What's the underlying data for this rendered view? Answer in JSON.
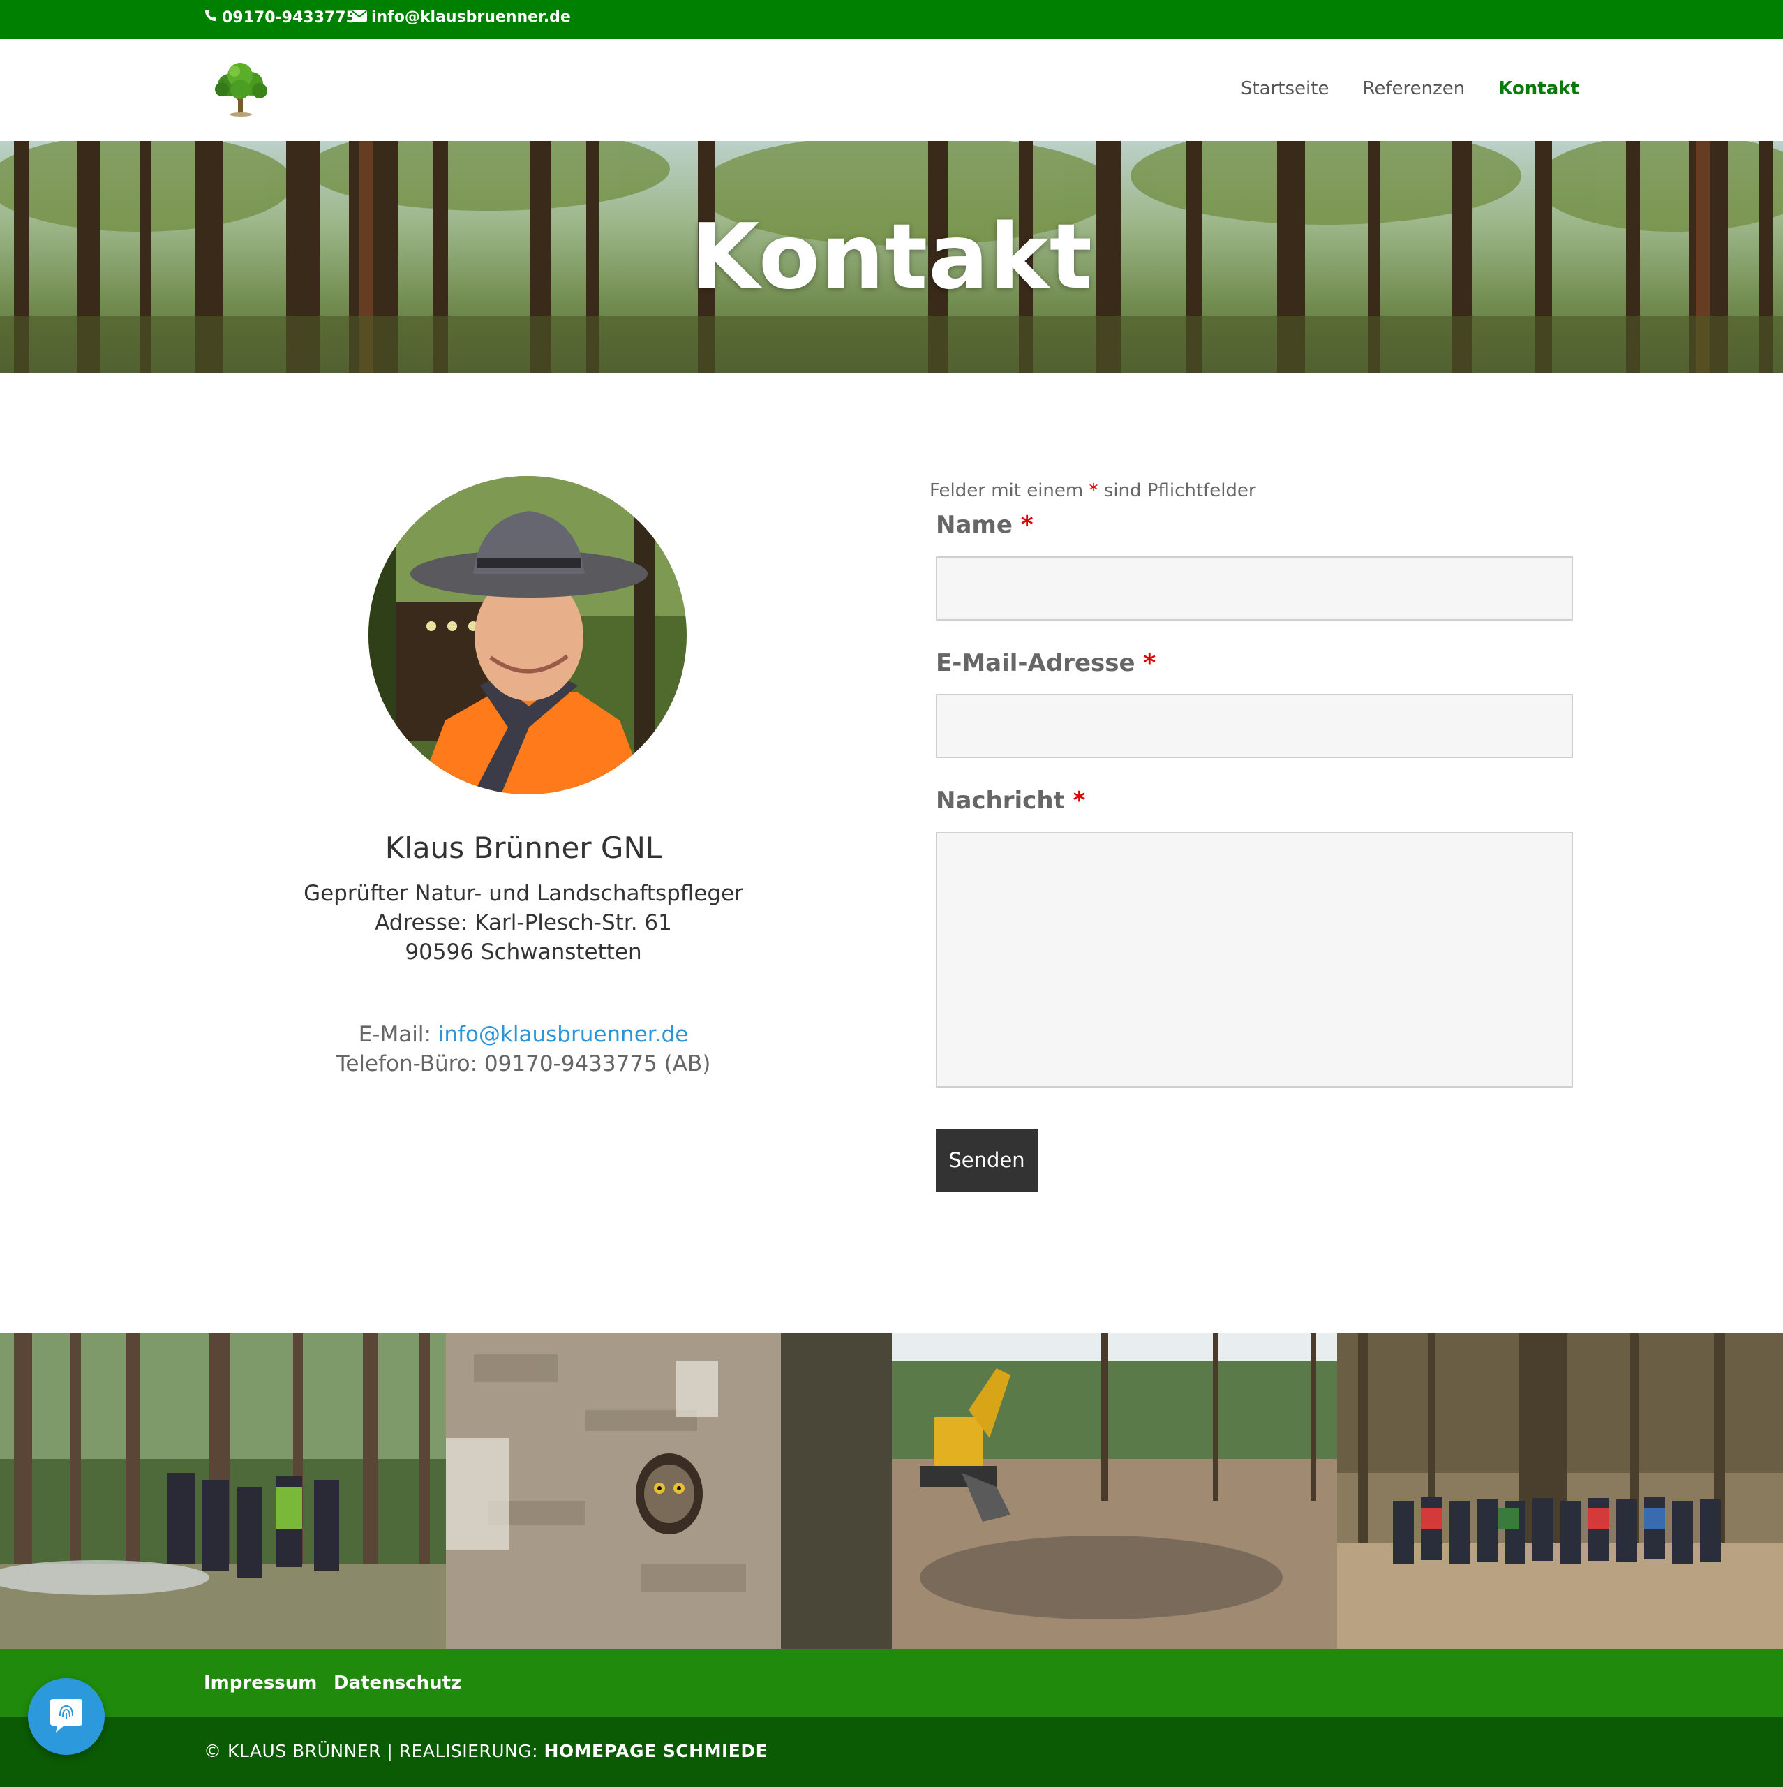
{
  "topbar": {
    "phone": "09170-9433775",
    "email": "info@klausbruenner.de",
    "phone_icon": "phone-icon",
    "email_icon": "envelope-icon",
    "background": "#008000"
  },
  "header": {
    "logo_icon": "tree-logo-icon",
    "nav": [
      {
        "label": "Startseite"
      },
      {
        "label": "Referenzen"
      },
      {
        "label": "Kontakt",
        "active": true
      }
    ],
    "active_color": "#0a7a0a"
  },
  "hero": {
    "title": "Kontakt"
  },
  "profile": {
    "name": "Klaus Brünner GNL",
    "title": "Geprüfter Natur- und Landschaftspfleger",
    "address": "Adresse: Karl-Plesch-Str. 61",
    "city": "90596 Schwanstetten",
    "email_label": "E-Mail: ",
    "email": "info@klausbruenner.de",
    "phone": "Telefon-Büro: 09170-9433775 (AB)"
  },
  "form": {
    "required_note_prefix": "Felder mit einem ",
    "required_star": "*",
    "required_note_suffix": " sind Pflichtfelder",
    "name_label": "Name",
    "email_label": "E-Mail-Adresse",
    "message_label": "Nachricht",
    "name_value": "",
    "email_value": "",
    "message_value": "",
    "submit_label": "Senden"
  },
  "gallery": [
    {
      "label": "forest-group-photo"
    },
    {
      "label": "owl-in-tree-photo"
    },
    {
      "label": "excavator-clearing-photo"
    },
    {
      "label": "large-group-photo"
    }
  ],
  "footer": {
    "links": [
      "Impressum",
      "Datenschutz"
    ],
    "copyright_prefix": "© KLAUS BRÜNNER | REALISIERUNG: ",
    "copyright_brand": "HOMEPAGE SCHMIEDE",
    "top_color": "#1f8a0c",
    "bottom_color": "#0b5a04",
    "fab_icon": "fingerprint-icon"
  }
}
